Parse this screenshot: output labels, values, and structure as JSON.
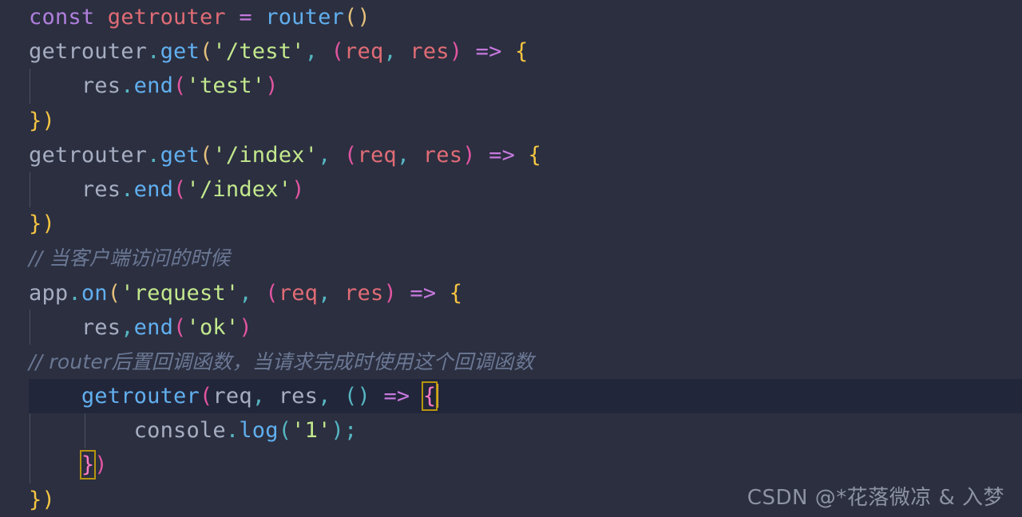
{
  "editor": {
    "background_color": "#2b2f40",
    "active_line_color": "#22263a",
    "language": "javascript",
    "cursor_line": 11
  },
  "code_lines": [
    {
      "n": 1,
      "text": "const getrouter = router()"
    },
    {
      "n": 2,
      "text": "getrouter.get('/test', (req, res) => {"
    },
    {
      "n": 3,
      "text": "    res.end('test')"
    },
    {
      "n": 4,
      "text": "})"
    },
    {
      "n": 5,
      "text": "getrouter.get('/index', (req, res) => {"
    },
    {
      "n": 6,
      "text": "    res.end('/index')"
    },
    {
      "n": 7,
      "text": "})"
    },
    {
      "n": 8,
      "text": "// 当客户端访问的时候"
    },
    {
      "n": 9,
      "text": "app.on('request', (req, res) => {"
    },
    {
      "n": 10,
      "text": "    res,end('ok')"
    },
    {
      "n": 11,
      "text": "// router后置回调函数，当请求完成时使用这个回调函数"
    },
    {
      "n": 12,
      "text": "    getrouter(req, res, () => {"
    },
    {
      "n": 13,
      "text": "        console.log('1');"
    },
    {
      "n": 14,
      "text": "    })"
    },
    {
      "n": 15,
      "text": "})"
    }
  ],
  "tokens": {
    "l1": {
      "kw": "const",
      "name": "getrouter",
      "assign": "=",
      "call": "router",
      "open": "(",
      "close": ")"
    },
    "l2": {
      "obj": "getrouter",
      "dot": ".",
      "method": "get",
      "lparen": "(",
      "str": "'/test'",
      "comma": ",",
      "aparen_l": "(",
      "p1": "req",
      "p2": "res",
      "aparen_r": ")",
      "arrow": "=>",
      "brace": "{"
    },
    "l3": {
      "obj": "res",
      "dot": ".",
      "method": "end",
      "lparen": "(",
      "str": "'test'",
      "rparen": ")"
    },
    "l4": {
      "brace": "}",
      "paren": ")"
    },
    "l5": {
      "obj": "getrouter",
      "dot": ".",
      "method": "get",
      "lparen": "(",
      "str": "'/index'",
      "comma": ",",
      "aparen_l": "(",
      "p1": "req",
      "p2": "res",
      "aparen_r": ")",
      "arrow": "=>",
      "brace": "{"
    },
    "l6": {
      "obj": "res",
      "dot": ".",
      "method": "end",
      "lparen": "(",
      "str": "'/index'",
      "rparen": ")"
    },
    "l7": {
      "brace": "}",
      "paren": ")"
    },
    "l8": {
      "comment": "// 当客户端访问的时候"
    },
    "l9": {
      "obj": "app",
      "dot": ".",
      "method": "on",
      "lparen": "(",
      "str": "'request'",
      "comma": ",",
      "aparen_l": "(",
      "p1": "req",
      "p2": "res",
      "aparen_r": ")",
      "arrow": "=>",
      "brace": "{"
    },
    "l10": {
      "obj": "res",
      "comma": ",",
      "method": "end",
      "lparen": "(",
      "str": "'ok'",
      "rparen": ")"
    },
    "l11": {
      "comment": "// router后置回调函数，当请求完成时使用这个回调函数"
    },
    "l12": {
      "fn": "getrouter",
      "lparen": "(",
      "a1": "req",
      "c1": ",",
      "a2": "res",
      "c2": ",",
      "eparen_l": "(",
      "eparen_r": ")",
      "arrow": "=>",
      "brace": "{"
    },
    "l13": {
      "obj": "console",
      "dot": ".",
      "method": "log",
      "lparen": "(",
      "str": "'1'",
      "rparen": ")",
      "semi": ";"
    },
    "l14": {
      "brace": "}",
      "paren": ")"
    },
    "l15": {
      "brace": "}",
      "paren": ")"
    }
  },
  "watermark": {
    "text": "CSDN @*花落微凉 & 入梦"
  },
  "theme_colors": {
    "background": "#2b2f40",
    "active_line": "#22263a",
    "keyword": "#b07fdd",
    "variable": "#e06c75",
    "identifier": "#a7aec2",
    "function": "#61afef",
    "string": "#c3e88d",
    "operator": "#c678dd",
    "punctuation": "#56b6c2",
    "brace_yellow": "#e5c07b",
    "brace_magenta": "#e255a1",
    "comment": "#6b7894",
    "bracket_match_outline": "#b8950f",
    "cursor": "#f0c040",
    "indent_guide": "#4b5263",
    "watermark": "#8d93a3"
  }
}
